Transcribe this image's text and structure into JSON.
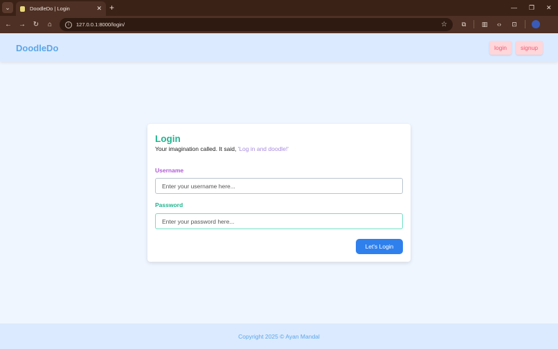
{
  "browser": {
    "tab": {
      "title": "DoodleDo | Login",
      "close": "✕"
    },
    "new_tab": "+",
    "window_controls": {
      "minimize": "—",
      "restore": "❐",
      "close": "✕"
    },
    "url": "127.0.0.1:8000/login/",
    "icons": {
      "tab_list": "⌄",
      "back": "←",
      "forward": "→",
      "reload": "↻",
      "home": "⌂",
      "site_info": "i",
      "bookmark_star": "☆",
      "extensions": "⧉",
      "sidebar": "▥",
      "devtools": "‹›",
      "cast": "⊡"
    }
  },
  "navbar": {
    "brand": "DoodleDo",
    "login_label": "login",
    "signup_label": "signup"
  },
  "login_card": {
    "title": "Login",
    "subtitle_prefix": "Your imagination called. It said, ",
    "subtitle_quote": "'Log in and doodle!'",
    "username_label": "Username",
    "username_placeholder": "Enter your username here...",
    "password_label": "Password",
    "password_placeholder": "Enter your password here...",
    "submit_label": "Let's Login"
  },
  "footer": {
    "copyright": "Copyright 2025 © Ayan Mandal"
  },
  "colors": {
    "brand": "#5aa7e8",
    "title_green": "#1fb58f",
    "username_purple": "#b05ad6",
    "button_blue": "#2f80ed",
    "nav_button_bg": "#ffd6da",
    "nav_button_text": "#ef5b73"
  }
}
